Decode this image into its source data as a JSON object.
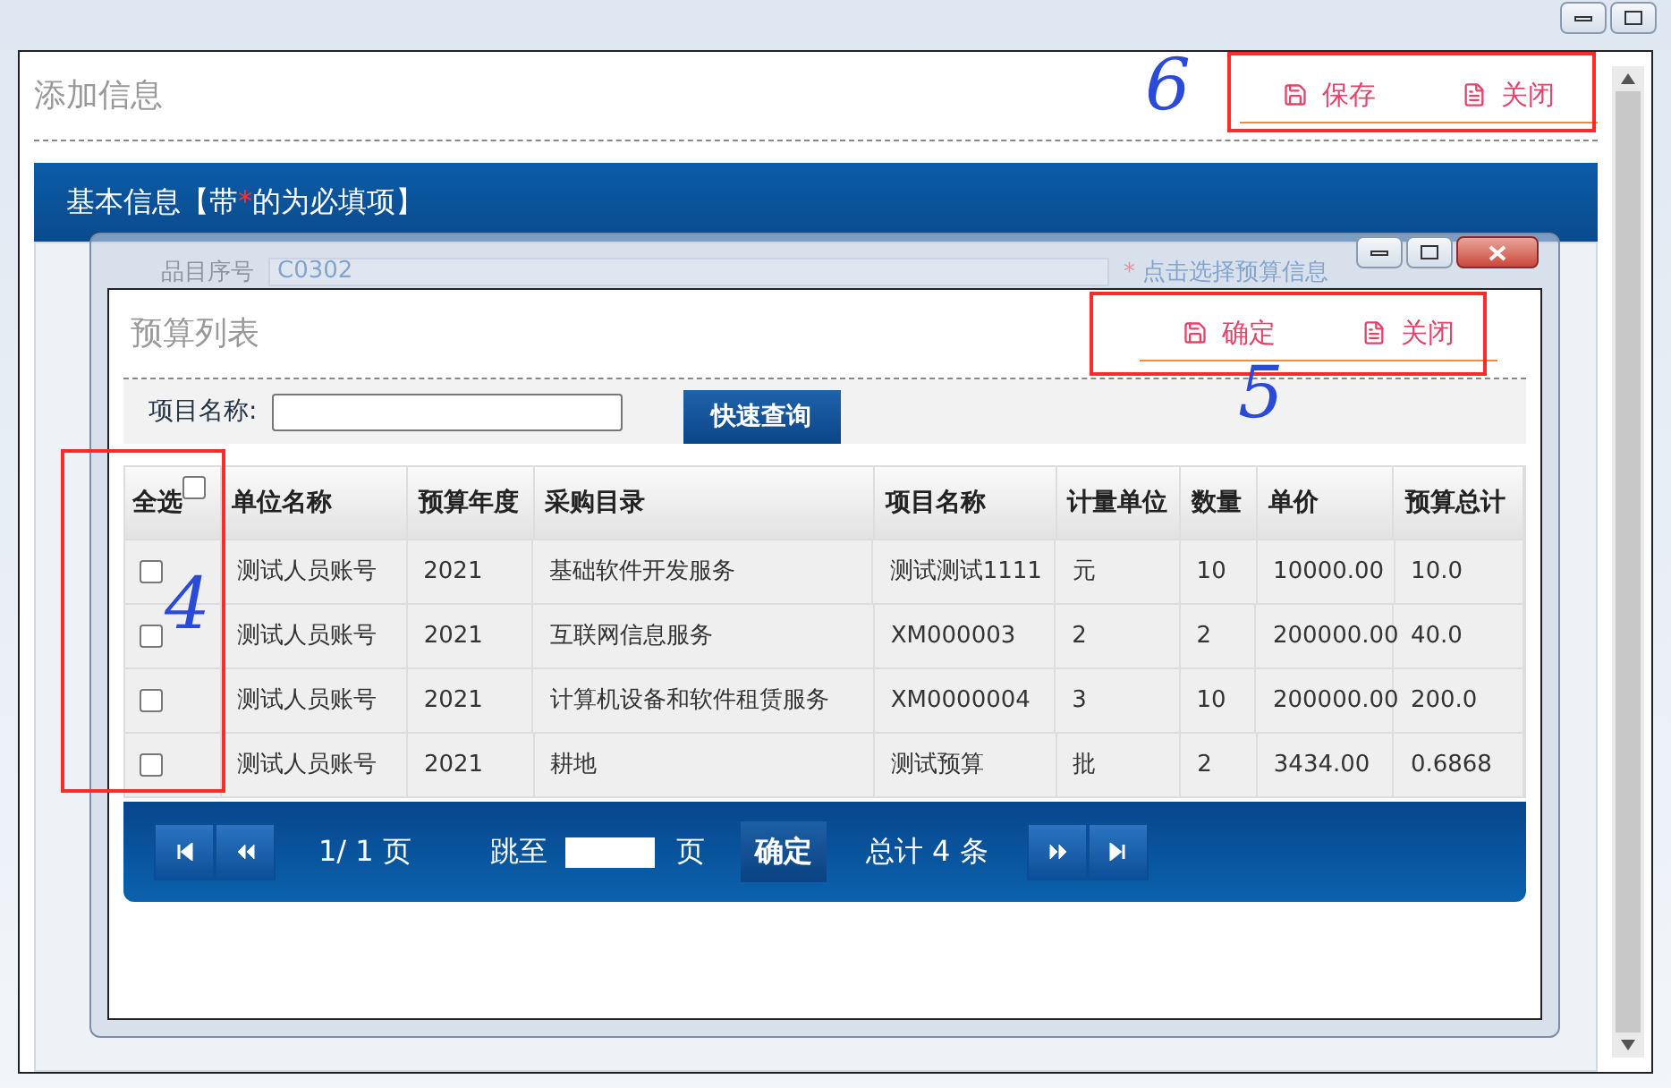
{
  "page": {
    "title": "添加信息",
    "toolbar": [
      {
        "kind": "save",
        "label": "保存"
      },
      {
        "kind": "close",
        "label": "关闭"
      }
    ]
  },
  "banner": {
    "prefix": "基本信息【带",
    "mark": "*",
    "suffix": "的为必填项】"
  },
  "form_row": {
    "label": "品目序号",
    "value": "C0302",
    "hint_mark": "*",
    "hint": "点击选择预算信息"
  },
  "dialog": {
    "title": "预算列表",
    "toolbar": [
      {
        "kind": "save",
        "label": "确定"
      },
      {
        "kind": "close",
        "label": "关闭"
      }
    ],
    "search": {
      "label": "项目名称:",
      "button": "快速查询"
    },
    "table": {
      "select_all": {
        "label": "全选",
        "checked": false
      },
      "columns": [
        "单位名称",
        "预算年度",
        "采购目录",
        "项目名称",
        "计量单位",
        "数量",
        "单价",
        "预算总计"
      ],
      "rows": [
        {
          "checked": false,
          "cells": [
            "测试人员账号",
            "2021",
            "基础软件开发服务",
            "测试测试1111",
            "元",
            "10",
            "10000.00",
            "10.0"
          ]
        },
        {
          "checked": false,
          "cells": [
            "测试人员账号",
            "2021",
            "互联网信息服务",
            "XM000003",
            "2",
            "2",
            "200000.00",
            "40.0"
          ]
        },
        {
          "checked": false,
          "cells": [
            "测试人员账号",
            "2021",
            "计算机设备和软件租赁服务",
            "XM0000004",
            "3",
            "10",
            "200000.00",
            "200.0"
          ]
        },
        {
          "checked": false,
          "cells": [
            "测试人员账号",
            "2021",
            "耕地",
            "测试预算",
            "批",
            "2",
            "3434.00",
            "0.6868"
          ]
        }
      ]
    },
    "pager": {
      "page_info": "1/ 1 页",
      "jump_label": "跳至",
      "jump_unit": "页",
      "go_button": "确定",
      "total": "总计 4 条"
    }
  },
  "annotations": [
    {
      "label": "6"
    },
    {
      "label": "5"
    },
    {
      "label": "4"
    }
  ]
}
